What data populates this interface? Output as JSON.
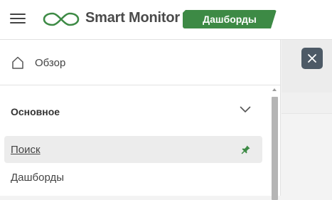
{
  "header": {
    "brand": "Smart Monitor",
    "badge": "Дашборды",
    "brand_color": "#3d8a45"
  },
  "sidebar": {
    "overview_label": "Обзор",
    "section": {
      "title": "Основное",
      "expanded": true,
      "items": [
        {
          "label": "Поиск",
          "active": true,
          "pinned": true
        },
        {
          "label": "Дашборды",
          "active": false,
          "pinned": false
        }
      ]
    }
  },
  "icons": {
    "menu": "hamburger-icon",
    "logo": "infinity-logo",
    "home": "home-icon",
    "chevron": "chevron-down-icon",
    "pin": "pin-icon",
    "close": "close-icon"
  },
  "colors": {
    "accent": "#3d8a45",
    "close_button": "#4d5a66",
    "active_item_bg": "#ececec"
  }
}
